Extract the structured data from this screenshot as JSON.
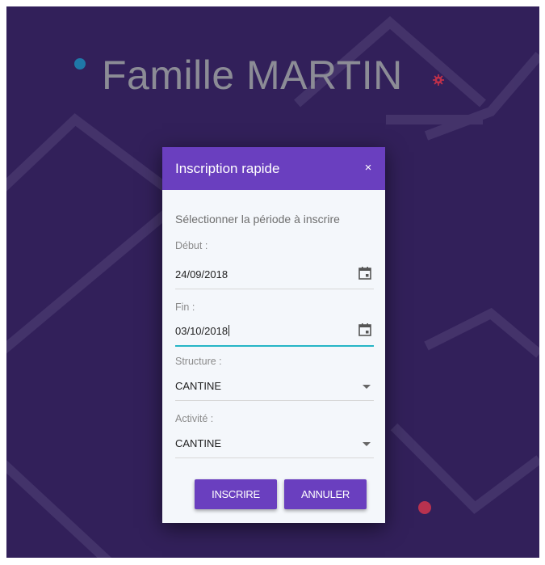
{
  "page": {
    "title": "Famille MARTIN",
    "colors": {
      "background": "#32205a",
      "accent": "#6a3fbf",
      "focus_underline": "#26b5c6",
      "dot_blue": "#1f78a8",
      "dot_red": "#b8324f"
    }
  },
  "modal": {
    "title": "Inscription rapide",
    "close_label": "×",
    "intro": "Sélectionner la période à inscrire",
    "fields": {
      "debut": {
        "label": "Début :",
        "value": "24/09/2018",
        "icon": "calendar-icon"
      },
      "fin": {
        "label": "Fin :",
        "value": "03/10/2018",
        "icon": "calendar-icon"
      },
      "structure": {
        "label": "Structure :",
        "value": "CANTINE",
        "icon": "chevron-down-icon"
      },
      "activite": {
        "label": "Activité :",
        "value": "CANTINE",
        "icon": "chevron-down-icon"
      }
    },
    "buttons": {
      "submit": "INSCRIRE",
      "cancel": "ANNULER"
    }
  }
}
